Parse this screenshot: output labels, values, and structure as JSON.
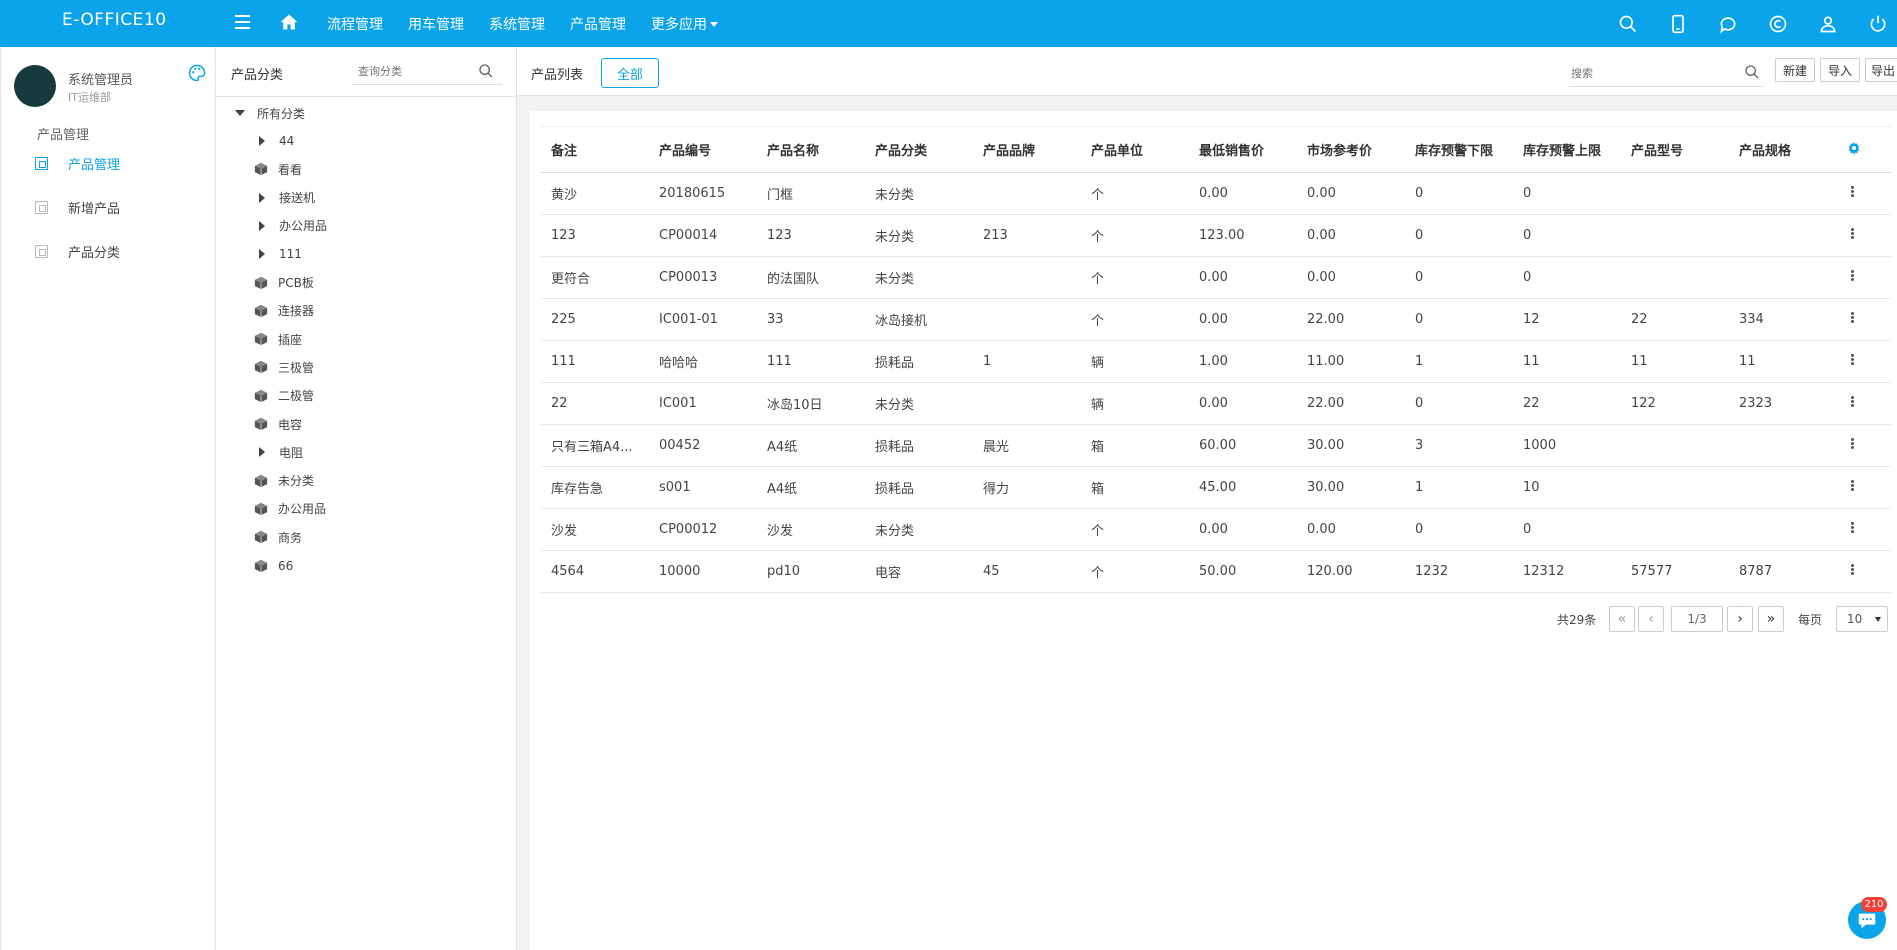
{
  "app": {
    "brand": "E-OFFICE10"
  },
  "nav": {
    "items": [
      "流程管理",
      "用车管理",
      "系统管理",
      "产品管理"
    ],
    "more_label": "更多应用"
  },
  "colors": {
    "accent": "#0ba3ea",
    "avatar": "#173a3f",
    "badge": "#f04134"
  },
  "top_icons": [
    "search-icon",
    "mobile-icon",
    "chat-sync-icon",
    "copyright-icon",
    "user-icon",
    "power-icon"
  ],
  "user": {
    "name": "系统管理员",
    "dept": "IT运维部"
  },
  "sidebar": {
    "group_label": "产品管理",
    "items": [
      {
        "label": "产品管理",
        "active": true
      },
      {
        "label": "新增产品",
        "active": false
      },
      {
        "label": "产品分类",
        "active": false
      }
    ]
  },
  "category_panel": {
    "title": "产品分类",
    "search_placeholder": "查询分类",
    "root": "所有分类",
    "items": [
      {
        "label": "44",
        "type": "expandable"
      },
      {
        "label": "看看",
        "type": "leaf"
      },
      {
        "label": "接送机",
        "type": "expandable"
      },
      {
        "label": "办公用品",
        "type": "expandable"
      },
      {
        "label": "111",
        "type": "expandable"
      },
      {
        "label": "PCB板",
        "type": "leaf"
      },
      {
        "label": "连接器",
        "type": "leaf"
      },
      {
        "label": "插座",
        "type": "leaf"
      },
      {
        "label": "三极管",
        "type": "leaf"
      },
      {
        "label": "二极管",
        "type": "leaf"
      },
      {
        "label": "电容",
        "type": "leaf"
      },
      {
        "label": "电阻",
        "type": "expandable"
      },
      {
        "label": "未分类",
        "type": "leaf"
      },
      {
        "label": "办公用品",
        "type": "leaf"
      },
      {
        "label": "商务",
        "type": "leaf"
      },
      {
        "label": "66",
        "type": "leaf"
      }
    ]
  },
  "main": {
    "list_title": "产品列表",
    "tab_all": "全部",
    "search_placeholder": "搜索",
    "buttons": {
      "new": "新建",
      "import": "导入",
      "export": "导出"
    }
  },
  "table": {
    "columns": [
      "备注",
      "产品编号",
      "产品名称",
      "产品分类",
      "产品品牌",
      "产品单位",
      "最低销售价",
      "市场参考价",
      "库存预警下限",
      "库存预警上限",
      "产品型号",
      "产品规格"
    ],
    "rows": [
      [
        "黄沙",
        "20180615",
        "门框",
        "未分类",
        "",
        "个",
        "0.00",
        "0.00",
        "0",
        "0",
        "",
        ""
      ],
      [
        "123",
        "CP00014",
        "123",
        "未分类",
        "213",
        "个",
        "123.00",
        "0.00",
        "0",
        "0",
        "",
        ""
      ],
      [
        "更符合",
        "CP00013",
        "的法国队",
        "未分类",
        "",
        "个",
        "0.00",
        "0.00",
        "0",
        "0",
        "",
        ""
      ],
      [
        "225",
        "IC001-01",
        "33",
        "冰岛接机",
        "",
        "个",
        "0.00",
        "22.00",
        "0",
        "12",
        "22",
        "334"
      ],
      [
        "111",
        "哈哈哈",
        "111",
        "损耗品",
        "1",
        "辆",
        "1.00",
        "11.00",
        "1",
        "11",
        "11",
        "11"
      ],
      [
        "22",
        "IC001",
        "冰岛10日",
        "未分类",
        "",
        "辆",
        "0.00",
        "22.00",
        "0",
        "22",
        "122",
        "2323"
      ],
      [
        "只有三箱A4...",
        "00452",
        "A4纸",
        "损耗品",
        "晨光",
        "箱",
        "60.00",
        "30.00",
        "3",
        "1000",
        "",
        ""
      ],
      [
        "库存告急",
        "s001",
        "A4纸",
        "损耗品",
        "得力",
        "箱",
        "45.00",
        "30.00",
        "1",
        "10",
        "",
        ""
      ],
      [
        "沙发",
        "CP00012",
        "沙发",
        "未分类",
        "",
        "个",
        "0.00",
        "0.00",
        "0",
        "0",
        "",
        ""
      ],
      [
        "4564",
        "10000",
        "pd10",
        "电容",
        "45",
        "个",
        "50.00",
        "120.00",
        "1232",
        "12312",
        "57577",
        "8787"
      ]
    ]
  },
  "pagination": {
    "total": "共29条",
    "page": "1/3",
    "per_page_label": "每页",
    "per_page": "10",
    "first": "«",
    "prev": "‹",
    "next": "›",
    "last": "»"
  },
  "chat": {
    "badge": "210"
  }
}
